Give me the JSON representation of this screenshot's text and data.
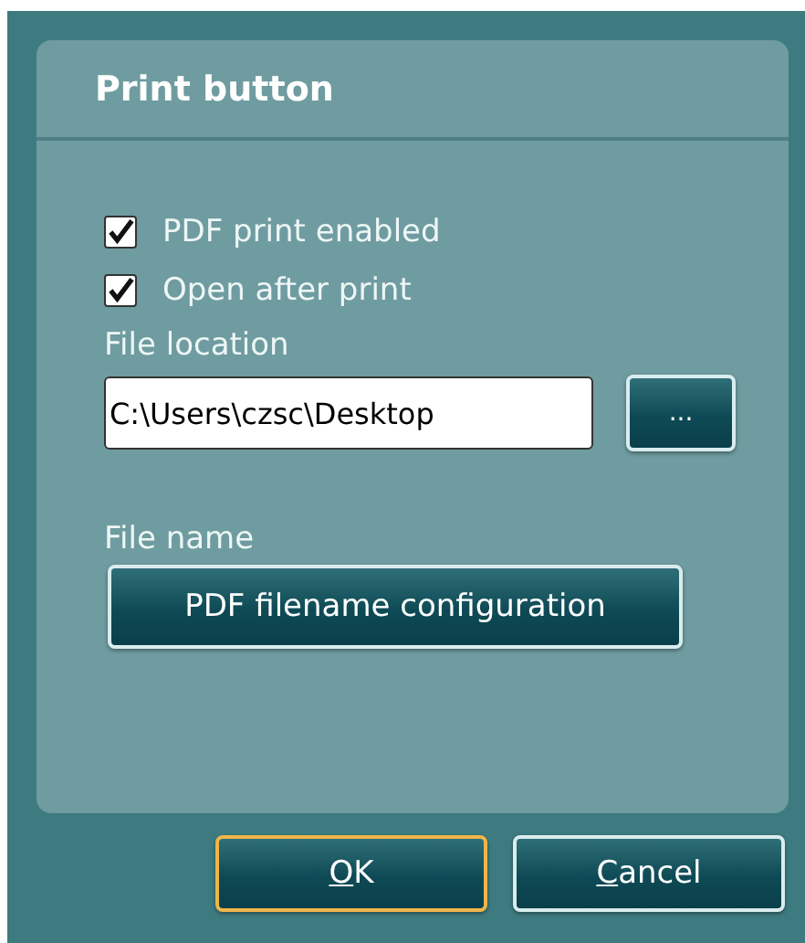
{
  "panel": {
    "title": "Print button"
  },
  "checkboxes": [
    {
      "label": "PDF print enabled",
      "checked": true
    },
    {
      "label": "Open after print",
      "checked": true
    }
  ],
  "file_location": {
    "label": "File location",
    "value": "C:\\Users\\czsc\\Desktop",
    "browse_button": "..."
  },
  "file_name": {
    "label": "File name",
    "button": "PDF filename configuration"
  },
  "buttons": [
    {
      "label": "OK",
      "first_letter_underlined": true,
      "default": true
    },
    {
      "label": "Cancel",
      "first_letter_underlined": true,
      "default": false
    }
  ]
}
